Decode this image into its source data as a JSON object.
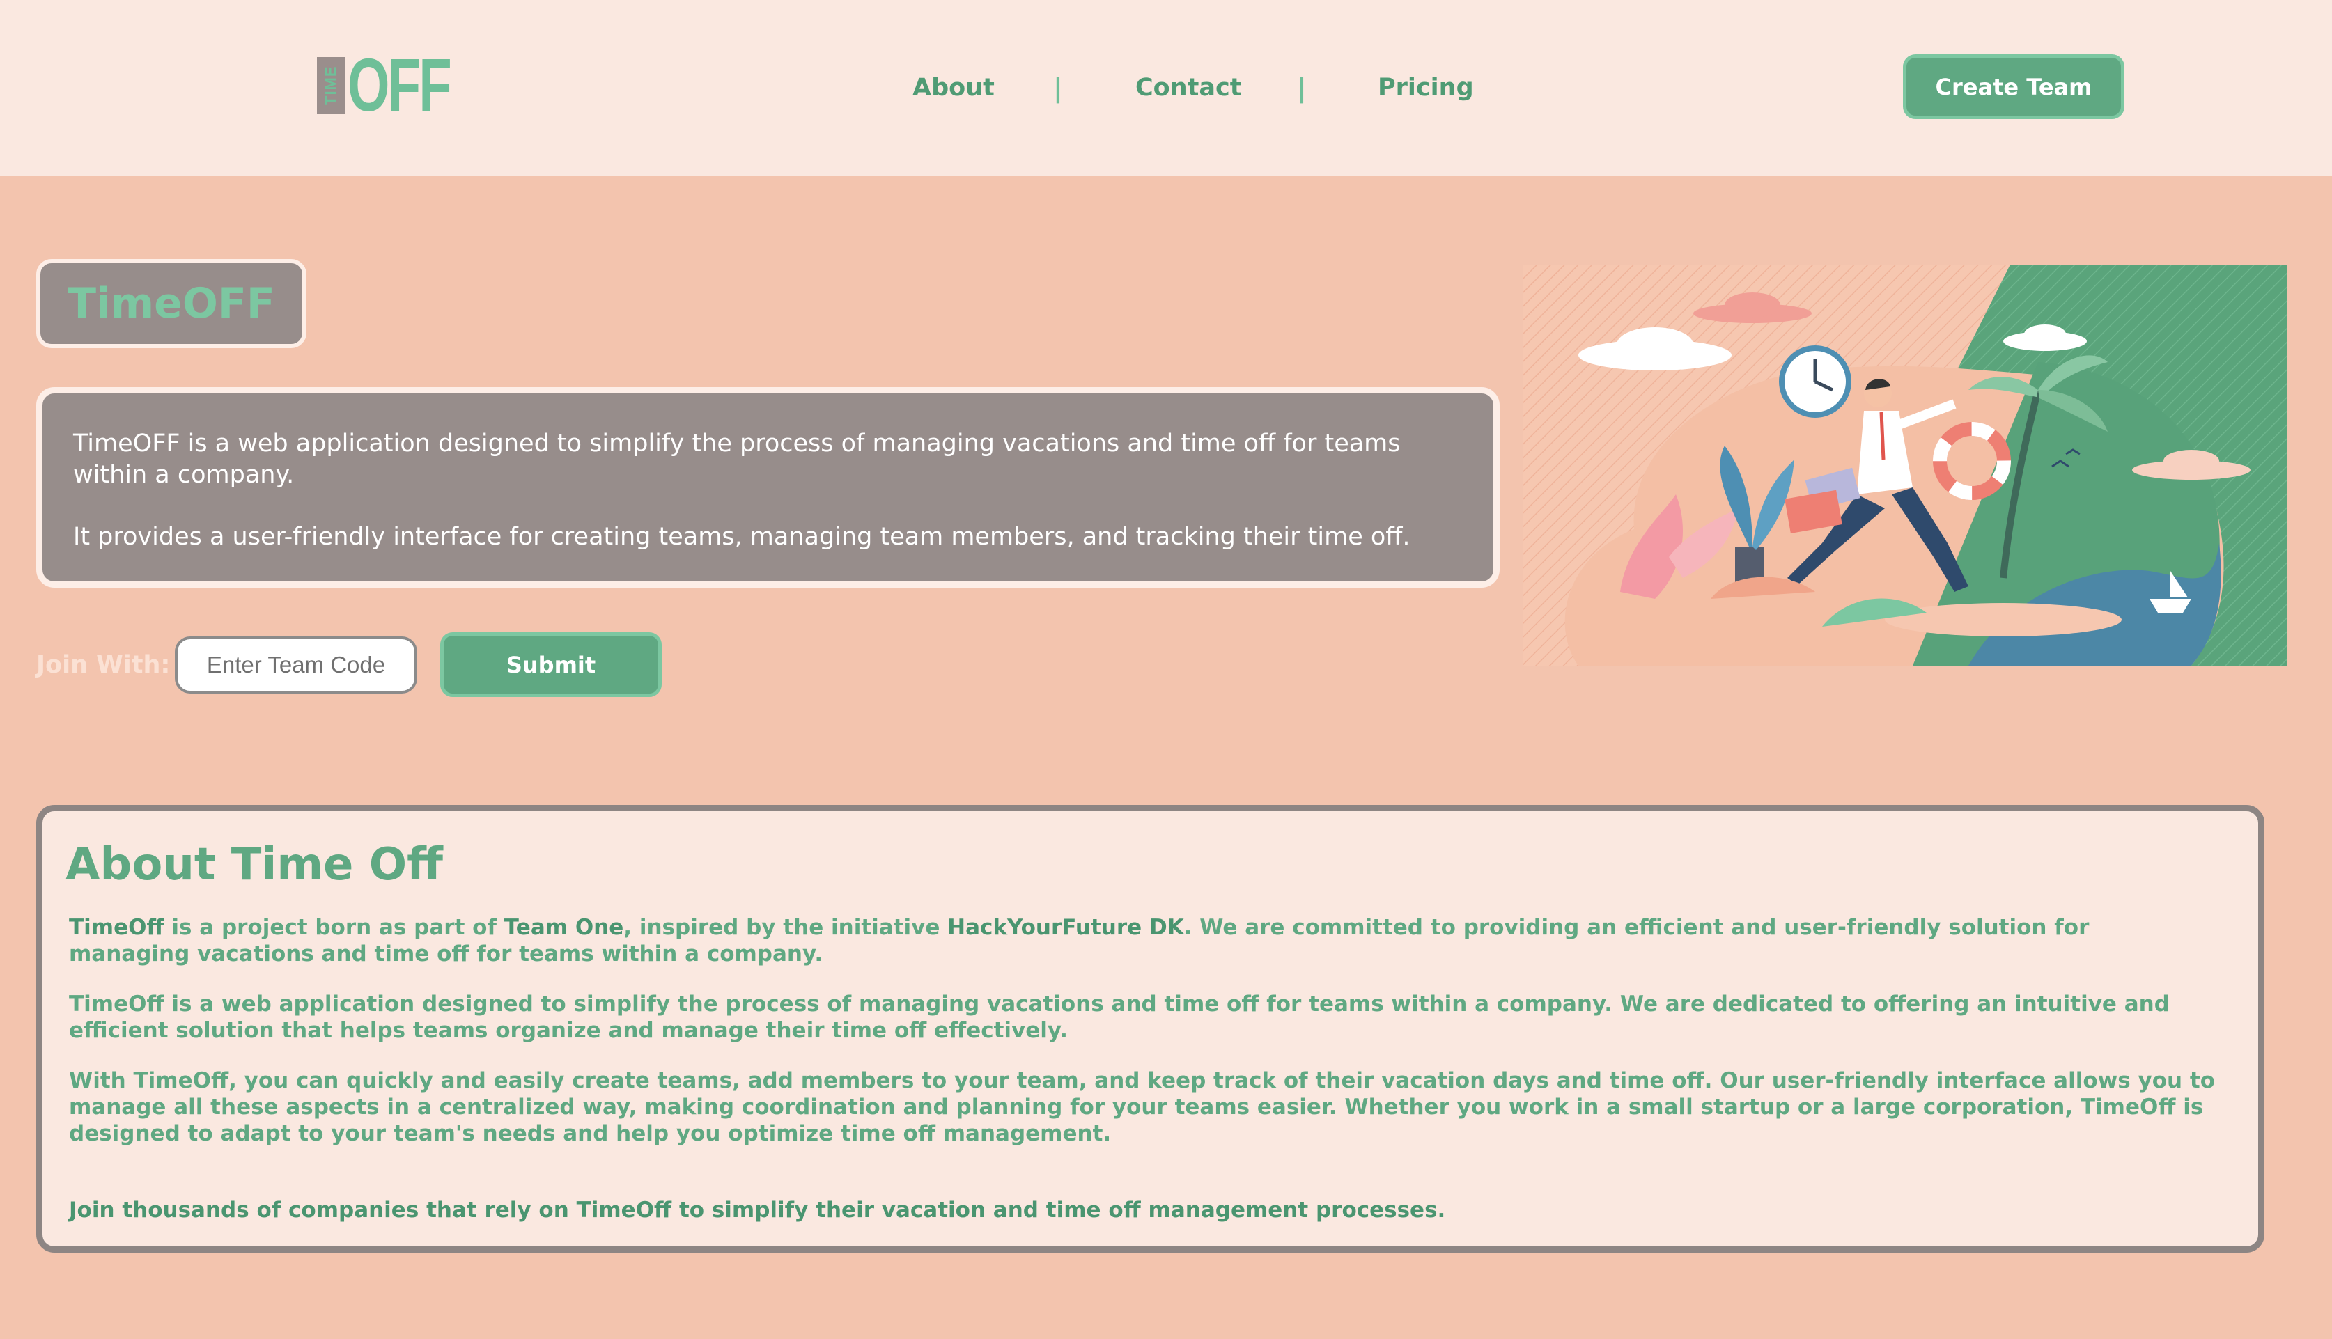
{
  "colors": {
    "page_bg": "#f3c4ae",
    "header_bg": "#fae8e0",
    "accent_green": "#5fa882",
    "accent_green_light": "#7cc7a1",
    "gray_panel": "#978d8b"
  },
  "header": {
    "logo_time": "TIME",
    "logo_off": "OFF",
    "nav": [
      {
        "label": "About"
      },
      {
        "label": "Contact"
      },
      {
        "label": "Pricing"
      }
    ],
    "separator": "|",
    "create_team_label": "Create Team"
  },
  "hero": {
    "title": "TimeOFF",
    "paragraphs": [
      "TimeOFF is a web application designed to simplify the process of managing vacations and time off for teams within a company.",
      "It provides a user-friendly interface for creating teams, managing team members, and tracking their time off."
    ],
    "join_label": "Join With:",
    "team_code_placeholder": "Enter Team Code",
    "submit_label": "Submit",
    "illustration_icon": "vacation-illustration"
  },
  "about": {
    "heading": "About Time Off",
    "p1": {
      "name1": "TimeOff",
      "t1": " is a project born as part of ",
      "name2": "Team One",
      "t2": ", inspired by the initiative ",
      "name3": "HackYourFuture DK",
      "t3": ". We are committed to providing an efficient and user-friendly solution for managing vacations and time off for teams within a company."
    },
    "p2": "TimeOff is a web application designed to simplify the process of managing vacations and time off for teams within a company. We are dedicated to offering an intuitive and efficient solution that helps teams organize and manage their time off effectively.",
    "p3": "With TimeOff, you can quickly and easily create teams, add members to your team, and keep track of their vacation days and time off. Our user-friendly interface allows you to manage all these aspects in a centralized way, making coordination and planning for your teams easier. Whether you work in a small startup or a large corporation, TimeOff is designed to adapt to your team's needs and help you optimize time off management.",
    "closing": "Join thousands of companies that rely on TimeOff to simplify their vacation and time off management processes."
  }
}
